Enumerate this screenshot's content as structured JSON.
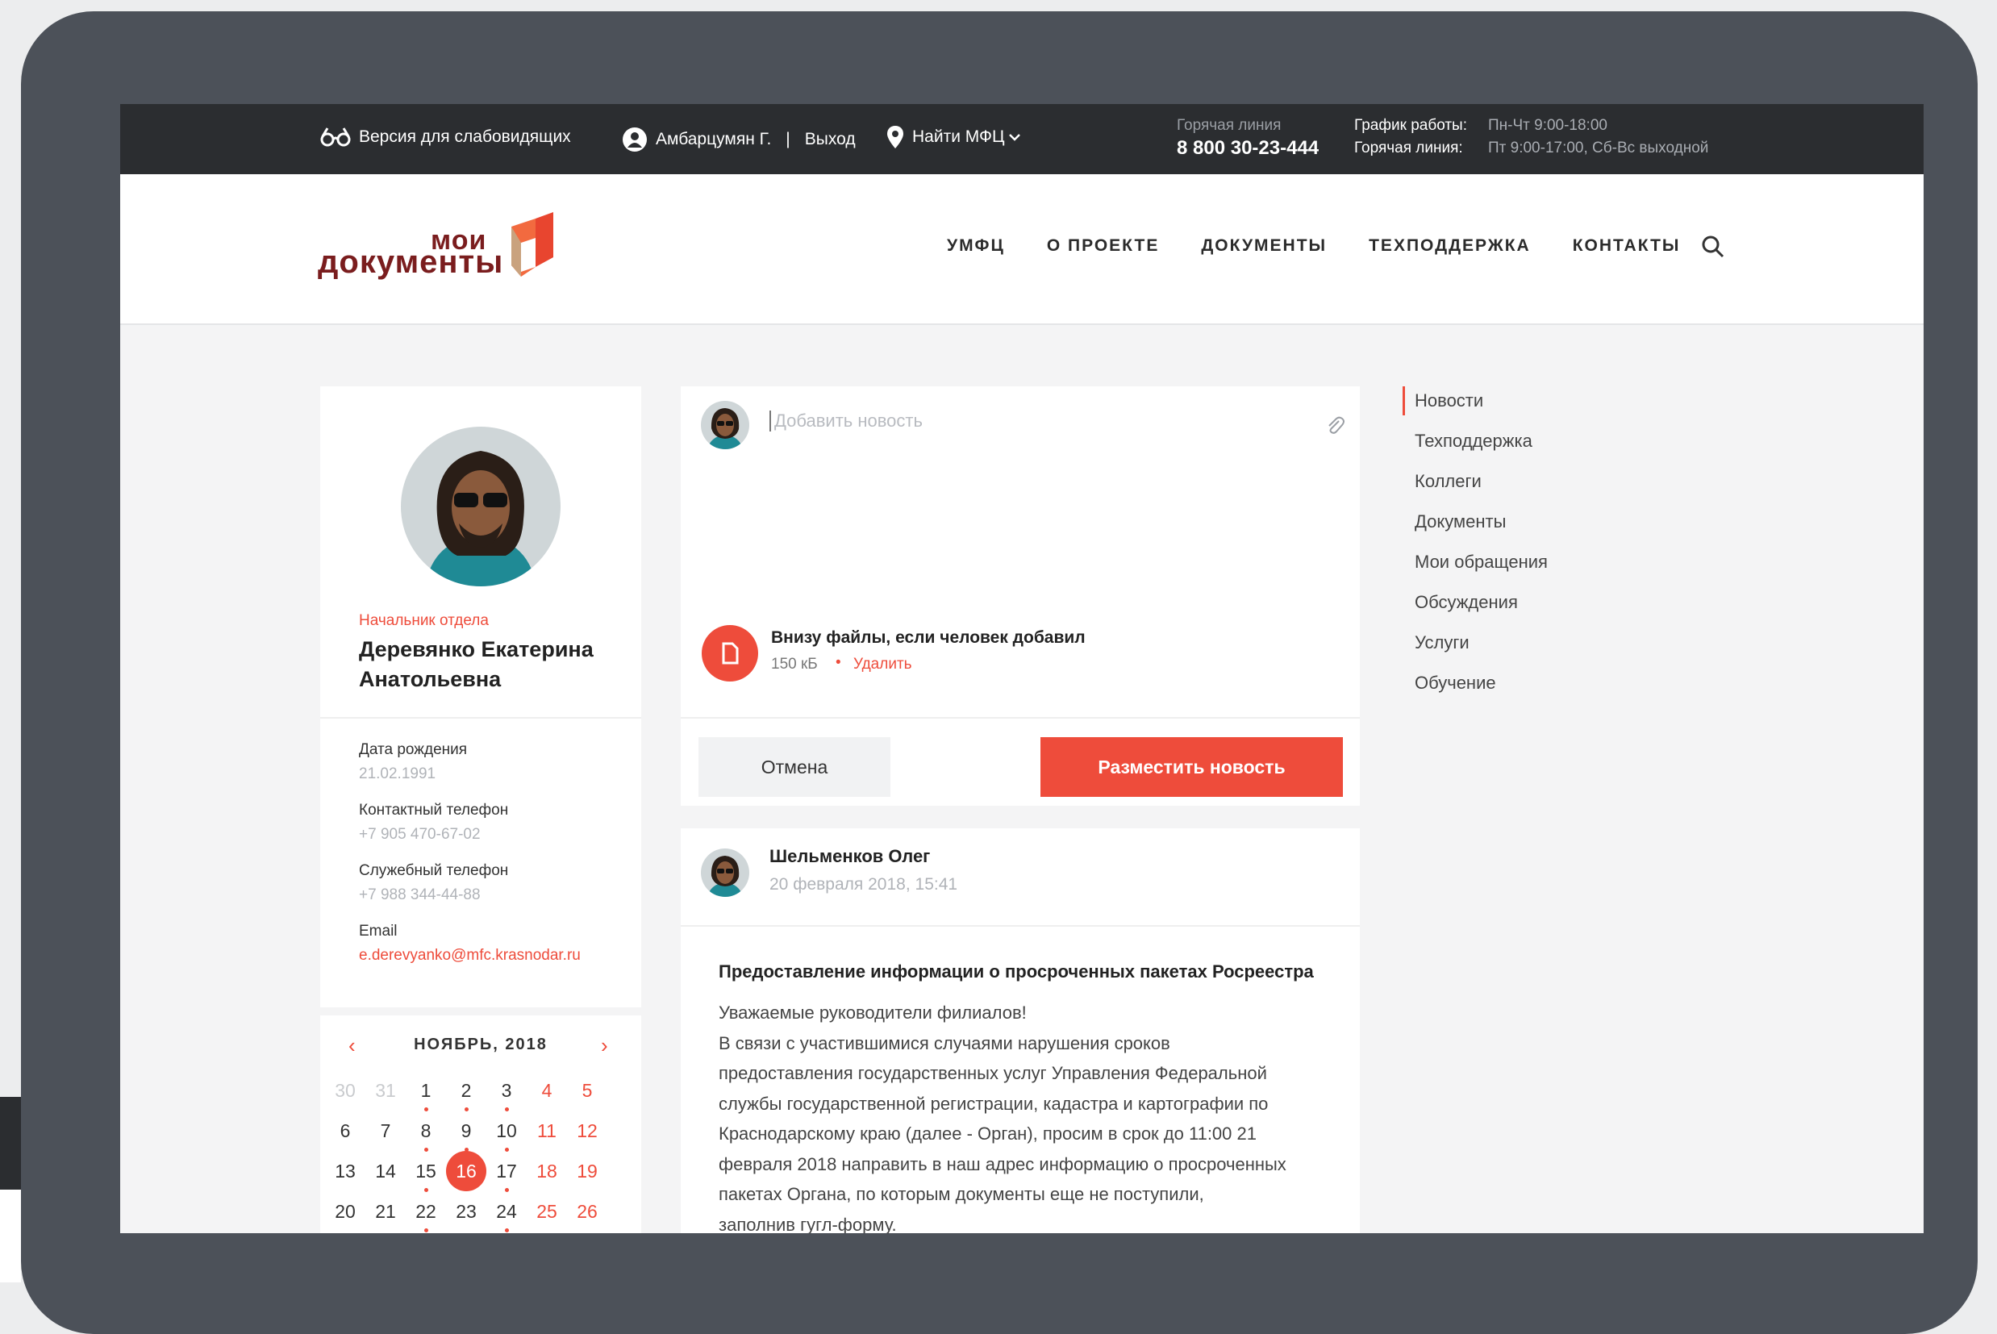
{
  "topbar": {
    "accessibility_label": "Версия для слабовидящих",
    "user_name": "Амбарцумян Г.",
    "separator": "|",
    "logout_label": "Выход",
    "find_mfc_label": "Найти МФЦ",
    "hotline_caption": "Горячая линия",
    "hotline_number": "8 800 30-23-444",
    "schedule_label": "График работы:",
    "schedule_value": "Пн-Чт 9:00-18:00",
    "schedule2_label": "Горячая линия:",
    "schedule2_value": "Пт 9:00-17:00, Сб-Вс выходной"
  },
  "logo": {
    "line1": "мои",
    "line2": "документы"
  },
  "nav": {
    "items": [
      "УМФЦ",
      "О ПРОЕКТЕ",
      "ДОКУМЕНТЫ",
      "ТЕХПОДДЕРЖКА",
      "КОНТАКТЫ"
    ]
  },
  "profile": {
    "role": "Начальник отдела",
    "name": "Деревянко Екатерина Анатольевна",
    "birth_label": "Дата рождения",
    "birth_value": "21.02.1991",
    "phone_label": "Контактный телефон",
    "phone_value": "+7 905 470-67-02",
    "work_phone_label": "Служебный телефон",
    "work_phone_value": "+7 988 344-44-88",
    "email_label": "Email",
    "email_value": "e.derevyanko@mfc.krasnodar.ru"
  },
  "calendar": {
    "title": "НОЯБРЬ, 2018",
    "prev": "‹",
    "next": "›",
    "weeks": [
      [
        "30",
        "31",
        "1",
        "2",
        "3",
        "4",
        "5"
      ],
      [
        "6",
        "7",
        "8",
        "9",
        "10",
        "11",
        "12"
      ],
      [
        "13",
        "14",
        "15",
        "16",
        "17",
        "18",
        "19"
      ],
      [
        "20",
        "21",
        "22",
        "23",
        "24",
        "25",
        "26"
      ]
    ],
    "today": "16"
  },
  "compose": {
    "placeholder": "Добавить новость",
    "file_name": "Внизу файлы, если человек добавил",
    "file_size": "150 кБ",
    "file_sep": "•",
    "file_delete": "Удалить",
    "cancel_label": "Отмена",
    "post_label": "Разместить новость"
  },
  "post": {
    "author": "Шельменков Олег",
    "date": "20 февраля 2018, 15:41",
    "title": "Предоставление информации о просроченных пакетах Росреестра",
    "body": "Уважаемые руководители филиалов!\nВ связи  с участившимися случаями нарушения сроков\nпредоставления государственных услуг Управления Федеральной\nслужбы государственной регистрации, кадастра и картографии по\nКраснодарскому краю (далее - Орган), просим в срок до 11:00 21\nфевраля 2018 направить в наш адрес информацию о просроченных\nпакетах  Органа, по которым документы еще не поступили,\nзаполнив гугл-форму."
  },
  "side_menu": {
    "items": [
      "Новости",
      "Техподдержка",
      "Коллеги",
      "Документы",
      "Мои обращения",
      "Обсуждения",
      "Услуги",
      "Обучение"
    ],
    "active_index": 0
  },
  "colors": {
    "accent": "#ee4c3b",
    "brand": "#7a1d1e",
    "topbar": "#2b2d30",
    "frame": "#4c5159"
  },
  "icons": [
    "glasses-icon",
    "user-icon",
    "location-pin-icon",
    "chevron-down-icon",
    "search-icon",
    "paperclip-icon",
    "document-icon"
  ]
}
